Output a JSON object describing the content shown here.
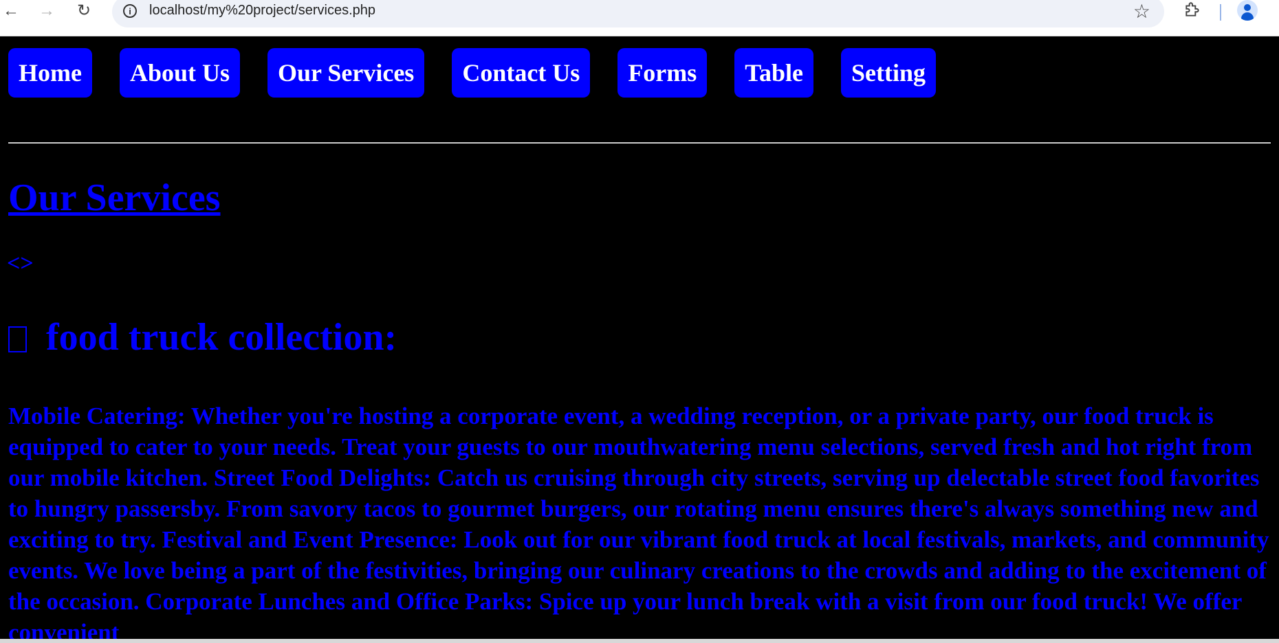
{
  "browser": {
    "url": "localhost/my%20project/services.php",
    "back_icon": "arrow-left-icon",
    "forward_icon": "arrow-right-icon",
    "reload_icon": "reload-icon",
    "site_info_icon": "info-icon",
    "bookmark_icon": "star-icon",
    "extensions_icon": "puzzle-icon",
    "profile_icon": "person-icon"
  },
  "nav": {
    "items": [
      {
        "label": "Home"
      },
      {
        "label": "About Us"
      },
      {
        "label": "Our Services"
      },
      {
        "label": "Contact Us"
      },
      {
        "label": "Forms"
      },
      {
        "label": "Table"
      },
      {
        "label": "Setting"
      }
    ],
    "item_bg_color": "#0000ff",
    "item_text_color": "#ffffff"
  },
  "main": {
    "title": "Our Services",
    "code_glyph": "<>",
    "section_heading": "food truck collection:",
    "paragraph": "Mobile Catering: Whether you're hosting a corporate event, a wedding reception, or a private party, our food truck is equipped to cater to your needs. Treat your guests to our mouthwatering menu selections, served fresh and hot right from our mobile kitchen. Street Food Delights: Catch us cruising through city streets, serving up delectable street food favorites to hungry passersby. From savory tacos to gourmet burgers, our rotating menu ensures there's always something new and exciting to try. Festival and Event Presence: Look out for our vibrant food truck at local festivals, markets, and community events. We love being a part of the festivities, bringing our culinary creations to the crowds and adding to the excitement of the occasion. Corporate Lunches and Office Parks: Spice up your lunch break with a visit from our food truck! We offer convenient",
    "text_color": "#0000ff",
    "background_color": "#000000"
  }
}
